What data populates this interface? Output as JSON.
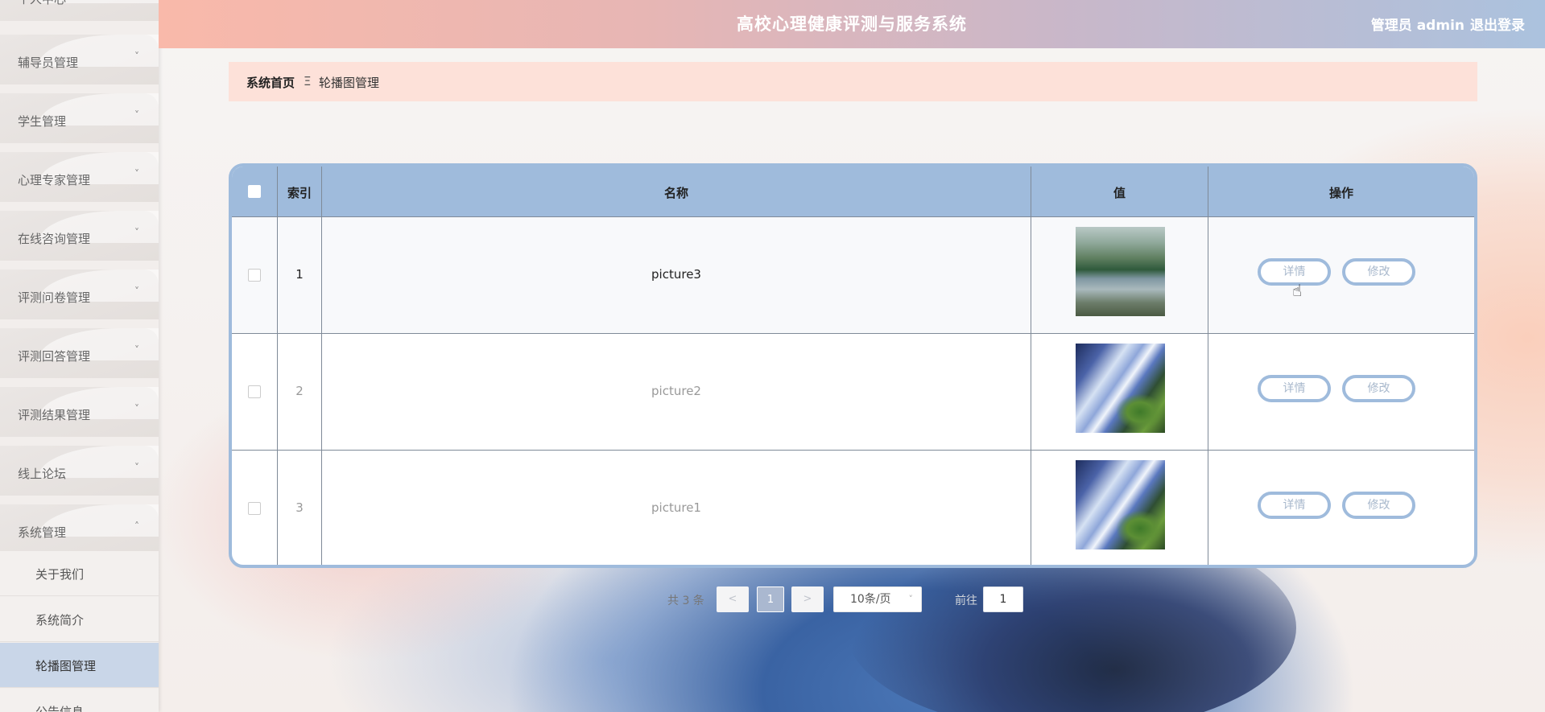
{
  "header": {
    "title": "高校心理健康评测与服务系统",
    "user": "管理员 admin",
    "logout": "退出登录"
  },
  "sidebar": {
    "items": [
      {
        "label": "个人中心",
        "chevron": "˅"
      },
      {
        "label": "辅导员管理",
        "chevron": "˅"
      },
      {
        "label": "学生管理",
        "chevron": "˅"
      },
      {
        "label": "心理专家管理",
        "chevron": "˅"
      },
      {
        "label": "在线咨询管理",
        "chevron": "˅"
      },
      {
        "label": "评测问卷管理",
        "chevron": "˅"
      },
      {
        "label": "评测回答管理",
        "chevron": "˅"
      },
      {
        "label": "评测结果管理",
        "chevron": "˅"
      },
      {
        "label": "线上论坛",
        "chevron": "˅"
      },
      {
        "label": "系统管理",
        "chevron": "˄"
      }
    ],
    "sub_items": [
      {
        "label": "关于我们"
      },
      {
        "label": "系统简介"
      },
      {
        "label": "轮播图管理"
      },
      {
        "label": "公告信息"
      }
    ]
  },
  "breadcrumb": {
    "home": "系统首页",
    "separator": "Ξ",
    "current": "轮播图管理"
  },
  "table": {
    "headers": [
      "索引",
      "名称",
      "值",
      "操作"
    ],
    "rows": [
      {
        "index": "1",
        "name": "picture3",
        "image": "lake-landscape-image"
      },
      {
        "index": "2",
        "name": "picture2",
        "image": "waterfall-image"
      },
      {
        "index": "3",
        "name": "picture1",
        "image": "waterfall-image"
      }
    ],
    "detail_label": "详情",
    "edit_label": "修改"
  },
  "pagination": {
    "total": "共 3 条",
    "prev": "<",
    "page": "1",
    "next": ">",
    "page_size": "10条/页",
    "goto_label": "前往",
    "goto_value": "1"
  },
  "colors": {
    "accent": "#9fbbdc",
    "breadcrumb_bg": "#fde1d9",
    "active_menu": "#c9d6e8"
  }
}
